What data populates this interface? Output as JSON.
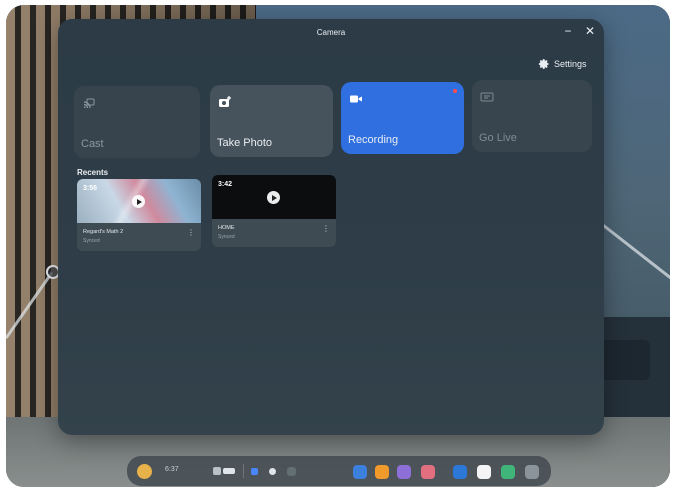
{
  "window": {
    "title": "Camera",
    "minimize_glyph": "−",
    "close_glyph": "✕"
  },
  "settings": {
    "label": "Settings",
    "icon": "gear-icon"
  },
  "tiles": [
    {
      "label": "Cast",
      "icon": "cast-icon",
      "state": "disabled"
    },
    {
      "label": "Take Photo",
      "icon": "camera-plus-icon",
      "state": "enabled"
    },
    {
      "label": "Recording",
      "icon": "video-camera-icon",
      "state": "active"
    },
    {
      "label": "Go Live",
      "icon": "live-icon",
      "state": "disabled"
    }
  ],
  "recents": {
    "title": "Recents",
    "items": [
      {
        "duration": "3:56",
        "name": "Regard's Math 2",
        "status": "Synced"
      },
      {
        "duration": "3:42",
        "name": "HOME",
        "status": "Synced"
      }
    ]
  },
  "taskbar": {
    "time": "6:37"
  },
  "colors": {
    "accent": "#2f6fe0",
    "window_bg": "#2e3d47",
    "tile_bg": "#46535c",
    "recording_dot": "#ff4b4b"
  }
}
